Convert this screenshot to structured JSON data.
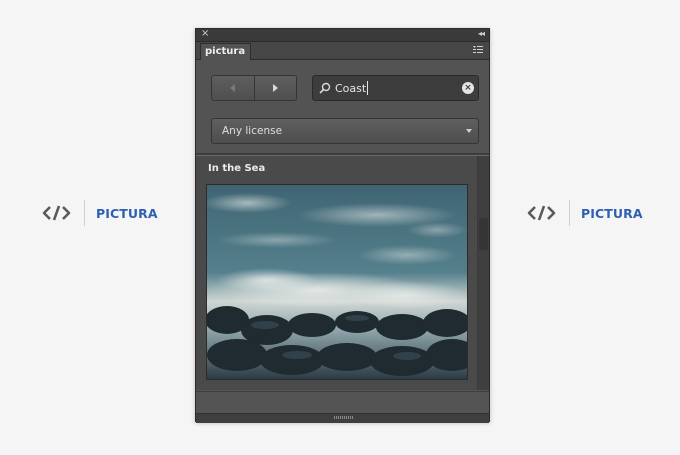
{
  "brand": {
    "name": "PICTURA",
    "accent": "#2f5fb3",
    "mark_icon": "code-brackets-icon"
  },
  "panel": {
    "tab_label": "pictura",
    "close_glyph": "×",
    "collapse_glyph": "◂◂",
    "menu_icon": "panel-menu-icon"
  },
  "navigation": {
    "back_icon": "triangle-left-icon",
    "forward_icon": "triangle-right-icon"
  },
  "search": {
    "value": "Coast",
    "placeholder": "",
    "icon": "search-icon",
    "clear_icon": "clear-icon"
  },
  "license_select": {
    "value": "Any license"
  },
  "results": {
    "section_title": "In the Sea",
    "items": [
      {
        "image": "sea-waves-on-rocks"
      }
    ]
  },
  "colors": {
    "panel_bg": "#535353",
    "accent_blue": "#2f5fb3"
  }
}
